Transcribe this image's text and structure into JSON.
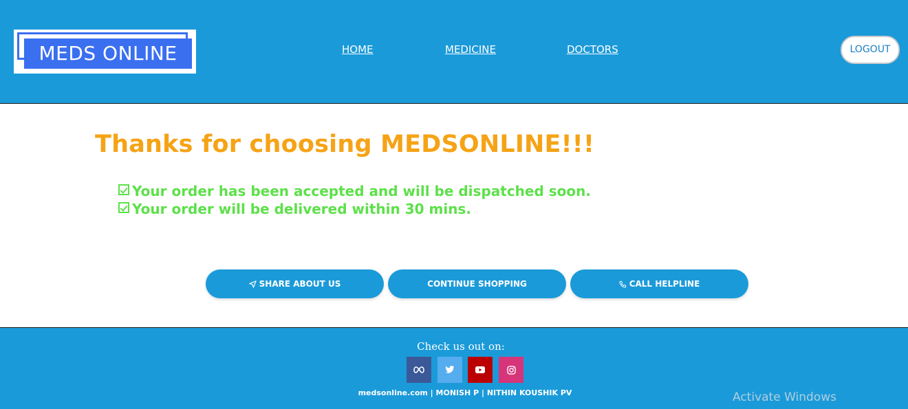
{
  "header": {
    "logo_text": "MEDS ONLINE",
    "nav": {
      "home": "HOME",
      "medicine": "MEDICINE",
      "doctors": "DOCTORS"
    },
    "logout_label": "LOGOUT"
  },
  "main": {
    "title": "Thanks for choosing MEDSONLINE!!!",
    "messages": [
      "Your order has been accepted and will be dispatched soon.",
      "Your order will be delivered within 30 mins."
    ],
    "buttons": {
      "share": "SHARE ABOUT US",
      "continue": "CONTINUE SHOPPING",
      "call": "CALL HELPLINE"
    }
  },
  "footer": {
    "check_us_out": "Check us out on:",
    "social_icons": [
      "meta-icon",
      "twitter-icon",
      "youtube-icon",
      "instagram-icon"
    ],
    "credits": "medsonline.com | MONISH P | NITHIN KOUSHIK PV"
  },
  "overlay": {
    "activate_windows": "Activate Windows"
  },
  "colors": {
    "primary_blue": "#1b9ad9",
    "logo_blue": "#3a6ff0",
    "title_orange": "#f5a316",
    "message_green": "#5de04a",
    "facebook": "#3b5998",
    "twitter": "#55acee",
    "youtube": "#bb0000",
    "instagram": "#d6357a"
  }
}
